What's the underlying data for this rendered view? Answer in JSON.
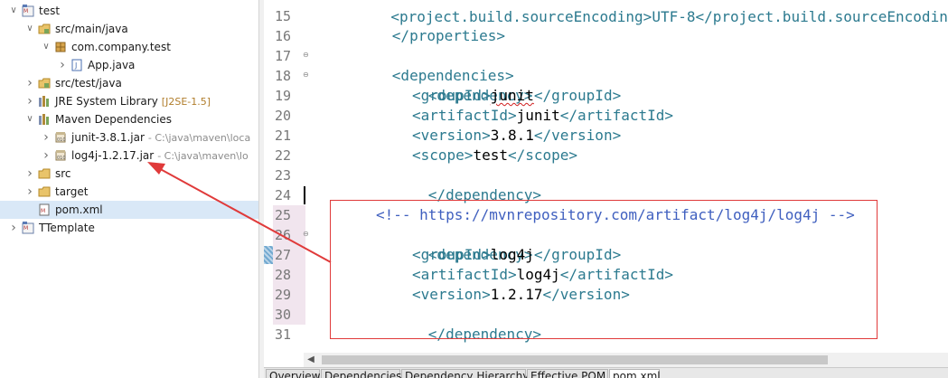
{
  "explorer": {
    "rows": [
      {
        "id": "test",
        "label": "test",
        "dec": "",
        "indent": 0,
        "arrow": "open",
        "icon": "maven-project-icon"
      },
      {
        "id": "src-main-java",
        "label": "src/main/java",
        "dec": "",
        "indent": 1,
        "arrow": "open",
        "icon": "source-folder-icon"
      },
      {
        "id": "com-company-test",
        "label": "com.company.test",
        "dec": "",
        "indent": 2,
        "arrow": "open",
        "icon": "package-icon"
      },
      {
        "id": "app-java",
        "label": "App.java",
        "dec": "",
        "indent": 3,
        "arrow": "closed",
        "icon": "java-file-icon"
      },
      {
        "id": "src-test-java",
        "label": "src/test/java",
        "dec": "",
        "indent": 1,
        "arrow": "closed",
        "icon": "source-folder-icon"
      },
      {
        "id": "jre-system-library",
        "label": "JRE System Library",
        "dec": "[J2SE-1.5]",
        "indent": 1,
        "arrow": "closed",
        "icon": "library-icon"
      },
      {
        "id": "maven-dependencies",
        "label": "Maven Dependencies",
        "dec": "",
        "indent": 1,
        "arrow": "open",
        "icon": "library-icon"
      },
      {
        "id": "junit-jar",
        "label": "junit-3.8.1.jar",
        "dec": "- C:\\java\\maven\\loca",
        "indent": 2,
        "arrow": "closed",
        "icon": "jar-icon"
      },
      {
        "id": "log4j-jar",
        "label": "log4j-1.2.17.jar",
        "dec": "- C:\\java\\maven\\lo",
        "indent": 2,
        "arrow": "closed",
        "icon": "jar-icon"
      },
      {
        "id": "src",
        "label": "src",
        "dec": "",
        "indent": 1,
        "arrow": "closed",
        "icon": "folder-icon"
      },
      {
        "id": "target",
        "label": "target",
        "dec": "",
        "indent": 1,
        "arrow": "closed",
        "icon": "folder-icon"
      },
      {
        "id": "pom-xml",
        "label": "pom.xml",
        "dec": "",
        "indent": 1,
        "arrow": "none",
        "icon": "xml-file-icon",
        "selected": true
      },
      {
        "id": "ttemplate",
        "label": "TTemplate",
        "dec": "",
        "indent": 0,
        "arrow": "closed",
        "icon": "maven-project-icon"
      }
    ]
  },
  "editor": {
    "lines": [
      {
        "n": "15",
        "fold": false,
        "hl": false
      },
      {
        "n": "16",
        "fold": false,
        "hl": false
      },
      {
        "n": "17",
        "fold": true,
        "hl": false
      },
      {
        "n": "18",
        "fold": true,
        "hl": false
      },
      {
        "n": "19",
        "fold": false,
        "hl": false
      },
      {
        "n": "20",
        "fold": false,
        "hl": false
      },
      {
        "n": "21",
        "fold": false,
        "hl": false
      },
      {
        "n": "22",
        "fold": false,
        "hl": false
      },
      {
        "n": "23",
        "fold": false,
        "hl": false
      },
      {
        "n": "24",
        "fold": false,
        "hl": false
      },
      {
        "n": "25",
        "fold": false,
        "hl": true
      },
      {
        "n": "26",
        "fold": true,
        "hl": true
      },
      {
        "n": "27",
        "fold": false,
        "hl": true
      },
      {
        "n": "28",
        "fold": false,
        "hl": true
      },
      {
        "n": "29",
        "fold": false,
        "hl": true
      },
      {
        "n": "30",
        "fold": false,
        "hl": true
      },
      {
        "n": "31",
        "fold": false,
        "hl": false
      }
    ],
    "partial_top": "    <project.build.sourceEncoding>UTF-8</project.build.sourceEncoding>",
    "code": {
      "l15": "</properties>",
      "l17": "<dependencies>",
      "l18": "<dependency>",
      "l19_open": "<groupId>",
      "l19_val": "junit",
      "l19_close": "</groupId>",
      "l20_open": "<artifactId>",
      "l20_val": "junit",
      "l20_close": "</artifactId>",
      "l21_open": "<version>",
      "l21_val": "3.8.1",
      "l21_close": "</version>",
      "l22_open": "<scope>",
      "l22_val": "test",
      "l22_close": "</scope>",
      "l23": "</dependency>",
      "l25_open": "<!-- ",
      "l25_url": "https://mvnrepository.com/artifact/log4j/log4j",
      "l25_close": " -->",
      "l26": "<dependency>",
      "l27_open": "<groupId>",
      "l27_val": "log4j",
      "l27_close": "</groupId>",
      "l28_open": "<artifactId>",
      "l28_val": "log4j",
      "l28_close": "</artifactId>",
      "l29_open": "<version>",
      "l29_val": "1.2.17",
      "l29_close": "</version>",
      "l30": "</dependency>"
    },
    "tabs": [
      "Overview",
      "Dependencies",
      "Dependency Hierarchy",
      "Effective POM",
      "pom.xml"
    ],
    "active_tab": "pom.xml"
  },
  "colors": {
    "annotation": "#e03a3a",
    "tag": "#2c7a8f",
    "comment": "#3f5fbf"
  }
}
